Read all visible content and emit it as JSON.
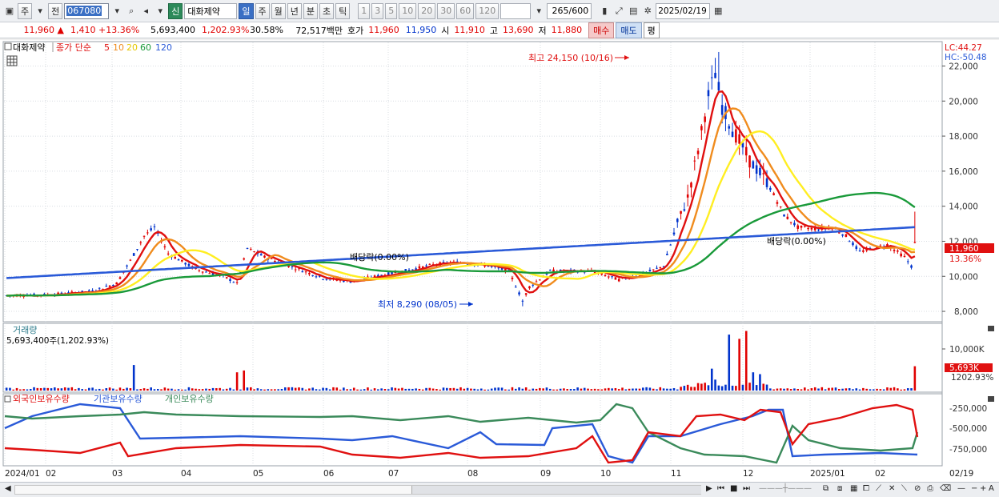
{
  "toolbar": {
    "period_tabs": [
      "주",
      "전"
    ],
    "code": "067080",
    "badge": "신",
    "stock_name": "대화제약",
    "intervals": [
      "일",
      "주",
      "월",
      "년",
      "분",
      "초",
      "틱"
    ],
    "active_interval": "일",
    "counts": [
      "1",
      "3",
      "5",
      "10",
      "20",
      "30",
      "60",
      "120"
    ],
    "bar_count": "265",
    "bar_max": "/600",
    "date": "2025/02/19"
  },
  "info": {
    "price": "11,960",
    "change": "1,410",
    "change_pct": "+13.36%",
    "volume": "5,693,400",
    "volume_ratio": "1,202.93%",
    "turnover": "30.58%",
    "amount": "72,517백만",
    "ask_label": "호가",
    "ask": "11,960",
    "bid": "11,950",
    "open_label": "시",
    "open": "11,910",
    "high_label": "고",
    "high": "13,690",
    "low_label": "저",
    "low": "11,880",
    "buy": "매수",
    "sell": "매도",
    "eval": "평"
  },
  "price_panel": {
    "name": "대화제약",
    "legend_prefix": "종가 단순",
    "ma_labels": [
      "5",
      "10",
      "20",
      "60",
      "120"
    ],
    "lc": "LC:44.27",
    "hc": "HC:-50.48",
    "high_annotation": "최고 24,150 (10/16)",
    "low_annotation": "최저 8,290 (08/05)",
    "dividend1": "배당락(0.00%)",
    "dividend2": "배당락(0.00%)",
    "y_ticks": [
      "22,000",
      "20,000",
      "18,000",
      "16,000",
      "14,000",
      "12,000",
      "10,000",
      "8,000"
    ],
    "last_price_tag": "11,960",
    "last_pct_tag": "13.36%"
  },
  "volume_panel": {
    "title": "거래량",
    "value": "5,693,400주(1,202.93%)",
    "y_tick": "10,000K",
    "last_tag": "5,693K",
    "last_pct": "1202.93%"
  },
  "holdings_panel": {
    "labels": [
      "외국인보유수량",
      "기관보유수량",
      "개인보유수량"
    ],
    "y_ticks": [
      "-250,000",
      "-500,000",
      "-750,000"
    ]
  },
  "x_axis": [
    "2024/01",
    "02",
    "03",
    "04",
    "05",
    "06",
    "07",
    "08",
    "09",
    "10",
    "11",
    "12",
    "2025/01",
    "02",
    "02/19"
  ],
  "colors": {
    "ma5": "#e01010",
    "ma10": "#f08c1e",
    "ma20": "#ffee22",
    "ma60": "#1a9a3a",
    "ma120": "#2a5ad8",
    "up": "#e00000",
    "down": "#0033cc",
    "foreign": "#e01010",
    "inst": "#2a5ad8",
    "retail": "#3a8a5a"
  },
  "chart_data": {
    "type": "line",
    "x": [
      "2024/01",
      "02",
      "03",
      "04",
      "05",
      "06",
      "07",
      "08",
      "09",
      "10",
      "11",
      "12",
      "2025/01",
      "02"
    ],
    "ylim": [
      7500,
      23300
    ],
    "series": [
      {
        "name": "종가",
        "values": [
          8900,
          9300,
          12200,
          9900,
          10800,
          9900,
          10600,
          9500,
          10300,
          20000,
          14500,
          12600,
          11200,
          10300
        ]
      },
      {
        "name": "120",
        "values": [
          10000,
          9900,
          10100,
          10200,
          10300,
          10350,
          10400,
          10300,
          10350,
          11000,
          12000,
          12400,
          12600,
          12700
        ]
      }
    ]
  }
}
